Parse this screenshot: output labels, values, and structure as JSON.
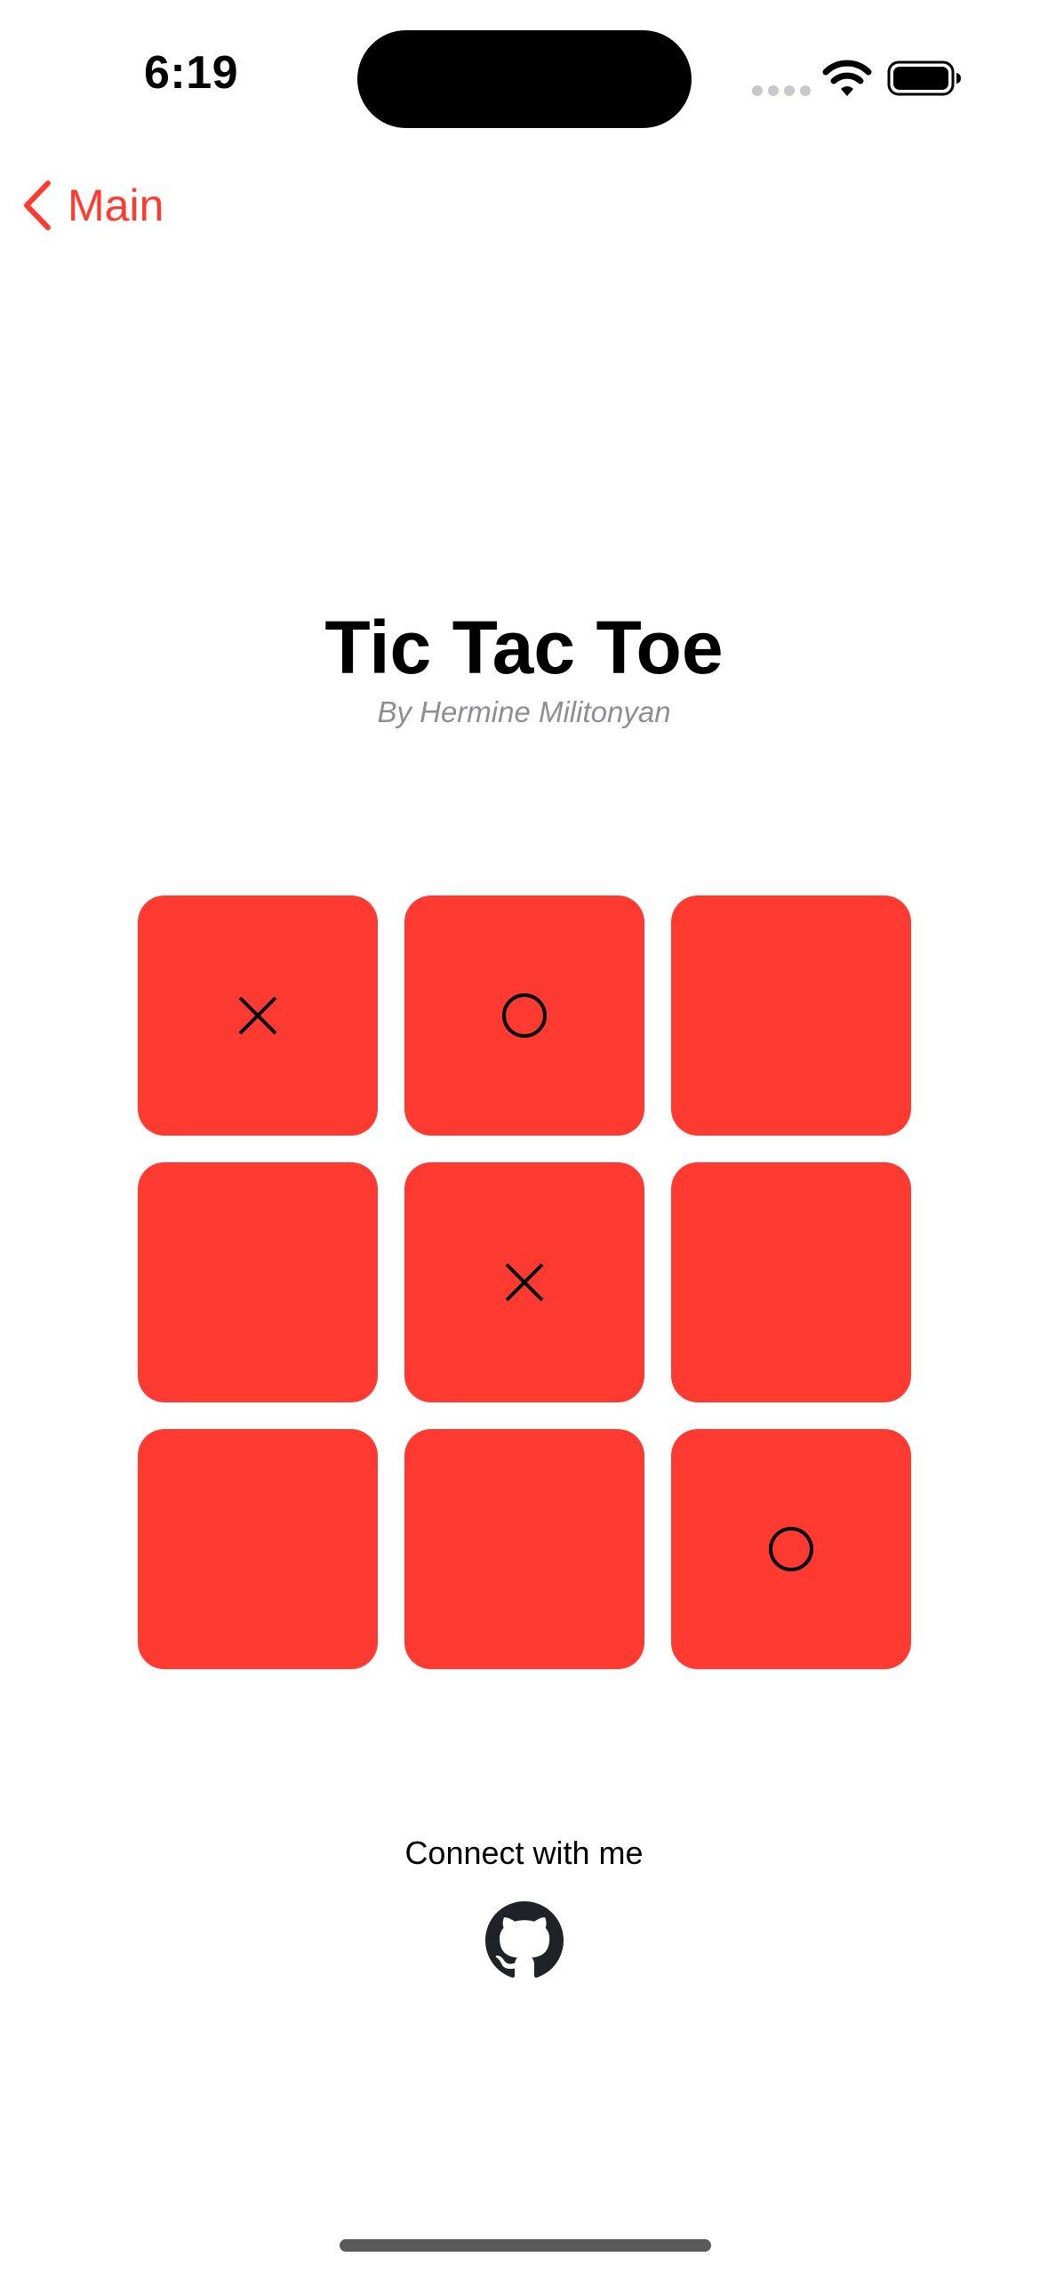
{
  "status_bar": {
    "time": "6:19",
    "signal_icon": "cellular-dots-icon",
    "wifi_icon": "wifi-icon",
    "battery_icon": "battery-icon"
  },
  "nav": {
    "back_icon": "chevron-left-icon",
    "back_label": "Main",
    "accent_color": "#ff3b30"
  },
  "header": {
    "title": "Tic Tac Toe",
    "subtitle": "By Hermine Militonyan"
  },
  "board": {
    "tile_color": "#ff3a30",
    "cells": [
      "X",
      "O",
      "",
      "",
      "X",
      "",
      "",
      "",
      "O"
    ]
  },
  "footer": {
    "connect_label": "Connect with me",
    "github_icon": "github-icon"
  }
}
